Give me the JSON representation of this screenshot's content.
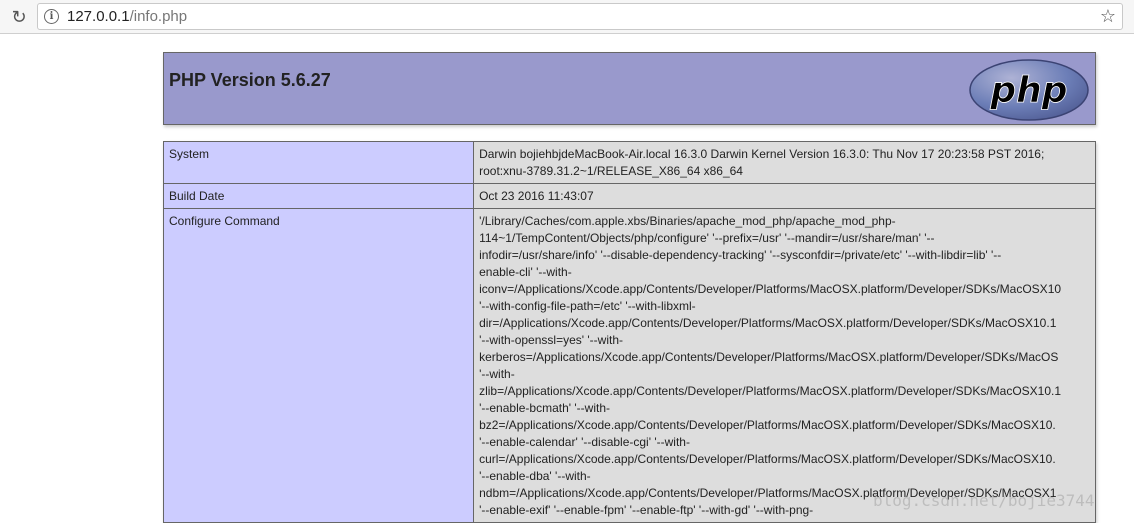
{
  "browser": {
    "url_host": "127.0.0.1",
    "url_path": "/info.php",
    "reload_icon": "reload-icon",
    "info_icon": "info-icon",
    "star_icon": "star-icon"
  },
  "header": {
    "title": "PHP Version 5.6.27",
    "logo_text": "php"
  },
  "rows": [
    {
      "key": "System",
      "lines": [
        "Darwin bojiehbjdeMacBook-Air.local 16.3.0 Darwin Kernel Version 16.3.0: Thu Nov 17 20:23:58 PST 2016;",
        "root:xnu-3789.31.2~1/RELEASE_X86_64 x86_64"
      ]
    },
    {
      "key": "Build Date",
      "lines": [
        "Oct 23 2016 11:43:07"
      ]
    },
    {
      "key": "Configure Command",
      "lines": [
        "'/Library/Caches/com.apple.xbs/Binaries/apache_mod_php/apache_mod_php-",
        "114~1/TempContent/Objects/php/configure' '--prefix=/usr' '--mandir=/usr/share/man' '--",
        "infodir=/usr/share/info' '--disable-dependency-tracking' '--sysconfdir=/private/etc' '--with-libdir=lib' '--",
        "enable-cli' '--with-",
        "iconv=/Applications/Xcode.app/Contents/Developer/Platforms/MacOSX.platform/Developer/SDKs/MacOSX10",
        "'--with-config-file-path=/etc' '--with-libxml-",
        "dir=/Applications/Xcode.app/Contents/Developer/Platforms/MacOSX.platform/Developer/SDKs/MacOSX10.1",
        "'--with-openssl=yes' '--with-",
        "kerberos=/Applications/Xcode.app/Contents/Developer/Platforms/MacOSX.platform/Developer/SDKs/MacOS",
        "'--with-",
        "zlib=/Applications/Xcode.app/Contents/Developer/Platforms/MacOSX.platform/Developer/SDKs/MacOSX10.1",
        "'--enable-bcmath' '--with-",
        "bz2=/Applications/Xcode.app/Contents/Developer/Platforms/MacOSX.platform/Developer/SDKs/MacOSX10.",
        "'--enable-calendar' '--disable-cgi' '--with-",
        "curl=/Applications/Xcode.app/Contents/Developer/Platforms/MacOSX.platform/Developer/SDKs/MacOSX10.",
        "'--enable-dba' '--with-",
        "ndbm=/Applications/Xcode.app/Contents/Developer/Platforms/MacOSX.platform/Developer/SDKs/MacOSX1",
        "'--enable-exif' '--enable-fpm' '--enable-ftp' '--with-gd' '--with-png-"
      ]
    }
  ],
  "watermark": "blog.csdn.net/bojie3744"
}
